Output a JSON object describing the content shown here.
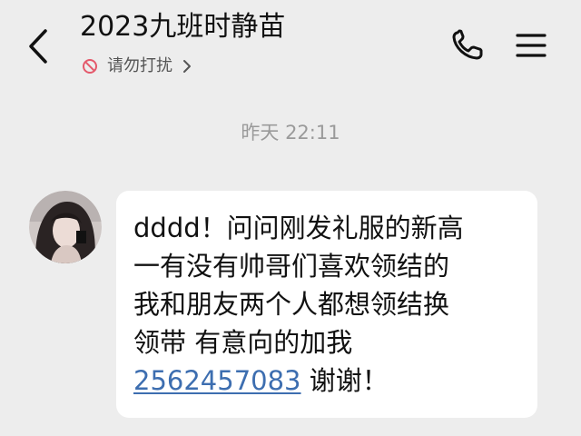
{
  "header": {
    "title": "2023九班时静苗",
    "dnd_label": "请勿打扰"
  },
  "icons": {
    "back": "chevron-left-icon",
    "dnd": "do-not-disturb-icon",
    "dnd_chevron": "chevron-right-icon",
    "call": "phone-icon",
    "menu": "hamburger-menu-icon"
  },
  "conversation": {
    "timestamp": "昨天 22:11",
    "messages": [
      {
        "lines": [
          "dddd！问问刚发礼服的新高",
          "一有没有帅哥们喜欢领结的",
          "我和朋友两个人都想领结换",
          "领带 有意向的加我"
        ],
        "phone": "2562457083",
        "suffix": " 谢谢！"
      }
    ]
  },
  "colors": {
    "background": "#ededed",
    "bubble": "#ffffff",
    "link": "#3d6eb0",
    "text": "#111111",
    "muted": "#9a9a9a"
  }
}
